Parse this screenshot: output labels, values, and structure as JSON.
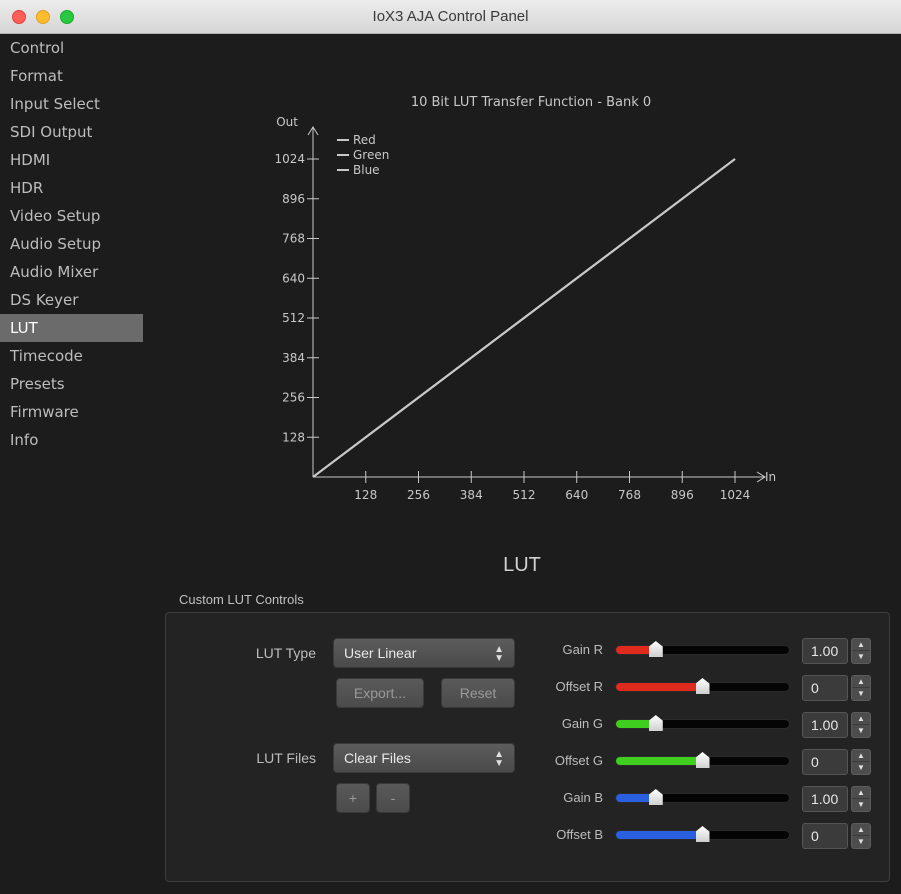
{
  "window": {
    "title": "IoX3 AJA Control Panel"
  },
  "sidebar": {
    "items": [
      {
        "label": "Control"
      },
      {
        "label": "Format"
      },
      {
        "label": "Input Select"
      },
      {
        "label": "SDI Output"
      },
      {
        "label": "HDMI"
      },
      {
        "label": "HDR"
      },
      {
        "label": "Video Setup"
      },
      {
        "label": "Audio Setup"
      },
      {
        "label": "Audio Mixer"
      },
      {
        "label": "DS Keyer"
      },
      {
        "label": "LUT"
      },
      {
        "label": "Timecode"
      },
      {
        "label": "Presets"
      },
      {
        "label": "Firmware"
      },
      {
        "label": "Info"
      }
    ],
    "active": "LUT"
  },
  "chart_data": {
    "type": "line",
    "title": "10 Bit LUT Transfer Function - Bank 0",
    "xlabel": "In",
    "ylabel": "Out",
    "xlim": [
      0,
      1024
    ],
    "ylim": [
      0,
      1024
    ],
    "xticks": [
      128,
      256,
      384,
      512,
      640,
      768,
      896,
      1024
    ],
    "yticks": [
      128,
      256,
      384,
      512,
      640,
      768,
      896,
      1024
    ],
    "grid": false,
    "legend_position": "top-left",
    "series": [
      {
        "name": "Red",
        "color": "#c8c8c8",
        "x": [
          0,
          1024
        ],
        "y": [
          0,
          1024
        ]
      },
      {
        "name": "Green",
        "color": "#c8c8c8",
        "x": [
          0,
          1024
        ],
        "y": [
          0,
          1024
        ]
      },
      {
        "name": "Blue",
        "color": "#c8c8c8",
        "x": [
          0,
          1024
        ],
        "y": [
          0,
          1024
        ]
      }
    ]
  },
  "lut": {
    "heading": "LUT",
    "group_label": "Custom LUT Controls",
    "lut_type_label": "LUT Type",
    "lut_type_value": "User Linear",
    "export_label": "Export...",
    "reset_label": "Reset",
    "lut_files_label": "LUT Files",
    "lut_files_value": "Clear Files",
    "plus_label": "+",
    "minus_label": "-",
    "sliders": [
      {
        "label": "Gain R",
        "value": "1.00",
        "level": 0.23,
        "color": "#e02a1e"
      },
      {
        "label": "Offset R",
        "value": "0",
        "level": 0.5,
        "color": "#e02a1e"
      },
      {
        "label": "Gain G",
        "value": "1.00",
        "level": 0.23,
        "color": "#3fcf1e"
      },
      {
        "label": "Offset G",
        "value": "0",
        "level": 0.5,
        "color": "#3fcf1e"
      },
      {
        "label": "Gain B",
        "value": "1.00",
        "level": 0.23,
        "color": "#2a5fe0"
      },
      {
        "label": "Offset B",
        "value": "0",
        "level": 0.5,
        "color": "#2a5fe0"
      }
    ]
  }
}
